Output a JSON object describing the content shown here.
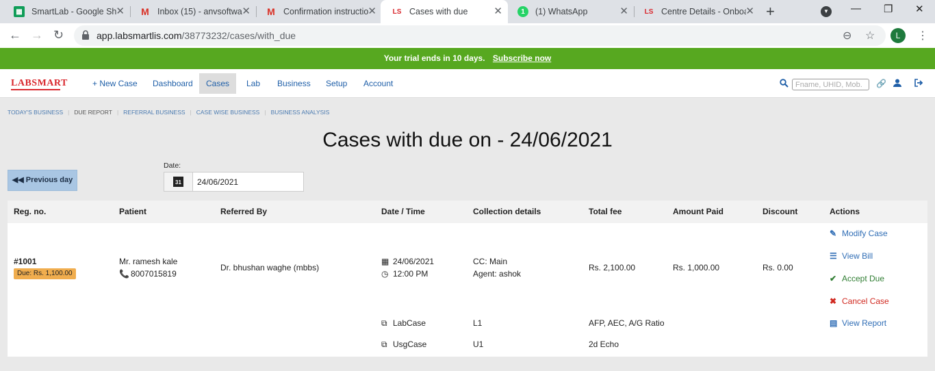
{
  "browser": {
    "tabs": [
      {
        "title": "SmartLab - Google Sh",
        "icon": "sheets-icon"
      },
      {
        "title": "Inbox (15) - anvsoftwa",
        "icon": "gmail-icon"
      },
      {
        "title": "Confirmation instructio",
        "icon": "gmail-icon"
      },
      {
        "title": "Cases with due",
        "icon": "labsmart-icon"
      },
      {
        "title": "(1) WhatsApp",
        "icon": "whatsapp-icon"
      },
      {
        "title": "Centre Details - Onboa",
        "icon": "labsmart-icon"
      }
    ],
    "url_host": "app.labsmartlis.com",
    "url_path": "/38773232/cases/with_due",
    "profile_initial": "L"
  },
  "trial_banner": {
    "text": "Your trial ends in 10 days.",
    "link": "Subscribe now"
  },
  "appnav": {
    "logo": "LABSMART",
    "items": [
      "+ New Case",
      "Dashboard",
      "Cases",
      "Lab",
      "Business",
      "Setup",
      "Account"
    ],
    "search_placeholder": "Fname, UHID, Mob."
  },
  "sublinks": [
    "TODAY'S BUSINESS",
    "DUE REPORT",
    "REFERRAL BUSINESS",
    "CASE WISE BUSINESS",
    "BUSINESS ANALYSIS"
  ],
  "page_title": "Cases with due on - 24/06/2021",
  "prev_button": "Previous day",
  "date": {
    "label": "Date:",
    "value": "24/06/2021",
    "cal_day": "31"
  },
  "table": {
    "headers": [
      "Reg. no.",
      "Patient",
      "Referred By",
      "Date / Time",
      "Collection details",
      "Total fee",
      "Amount Paid",
      "Discount",
      "Actions"
    ],
    "row": {
      "reg_no": "#1001",
      "due_badge": "Due: Rs. 1,100.00",
      "patient_name": "Mr. ramesh kale",
      "patient_phone": "8007015819",
      "referred_by": "Dr. bhushan waghe (mbbs)",
      "date": "24/06/2021",
      "time": "12:00 PM",
      "collection_center": "CC: Main",
      "agent": "Agent: ashok",
      "total_fee": "Rs. 2,100.00",
      "amount_paid": "Rs. 1,000.00",
      "discount": "Rs. 0.00",
      "subcases": [
        {
          "type": "LabCase",
          "id": "L1",
          "tests": "AFP, AEC, A/G Ratio"
        },
        {
          "type": "UsgCase",
          "id": "U1",
          "tests": "2d Echo"
        }
      ],
      "actions": {
        "modify": "Modify Case",
        "view_bill": "View Bill",
        "accept_due": "Accept Due",
        "cancel": "Cancel Case",
        "view_report": "View Report"
      }
    }
  },
  "colors": {
    "trial_green": "#57a820",
    "link_blue": "#2f6db5",
    "badge_orange": "#f0ad4e",
    "cancel_red": "#d0281f"
  }
}
